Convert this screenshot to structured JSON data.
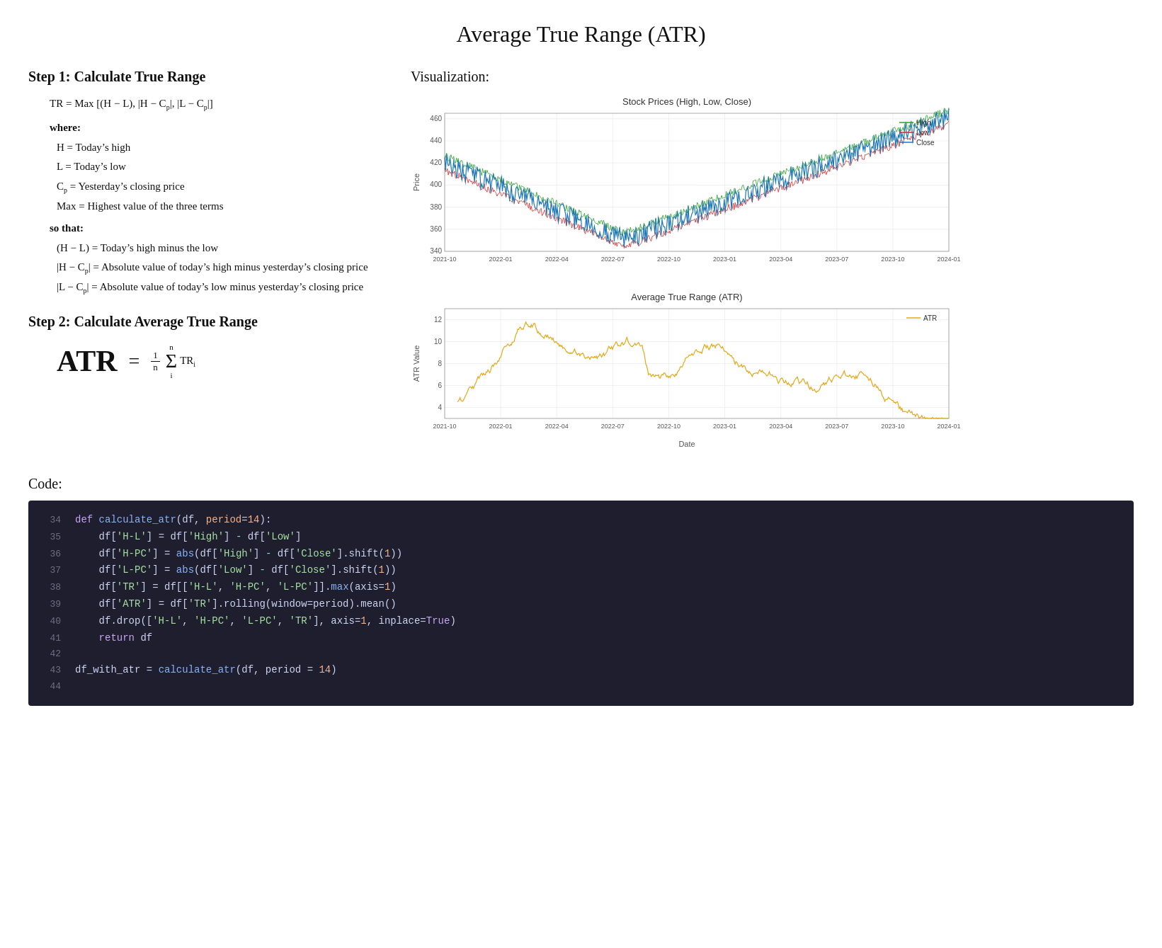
{
  "title": "Average True Range (ATR)",
  "step1": {
    "title": "Step 1: Calculate True Range",
    "formula": "TR = Max [(H − L), |H − C_p|, |L − C_p|]",
    "where_label": "where:",
    "variables": [
      "H = Today's high",
      "L = Today's low",
      "C_p = Yesterday's closing price",
      "Max = Highest value of the three terms"
    ],
    "sothat_label": "so that:",
    "terms": [
      "(H − L) = Today's high minus the low",
      "|H − C_p| = Absolute value of today's high minus yesterday's closing price",
      "|L − C_p| = Absolute value of today's low minus yesterday's closing price"
    ]
  },
  "step2": {
    "title": "Step 2: Calculate Average True Range",
    "atr_label": "ATR =",
    "formula_desc": "(1/n) Σ TR_i"
  },
  "visualization": {
    "title": "Visualization:",
    "chart1_title": "Stock Prices (High, Low, Close)",
    "chart2_title": "Average True Range (ATR)",
    "legend": {
      "high": "High",
      "low": "Low",
      "close": "Close",
      "atr": "ATR"
    },
    "xaxis_label": "Date",
    "yaxis1_label": "Price",
    "yaxis2_label": "ATR Value",
    "x_ticks": [
      "2021-10",
      "2022-01",
      "2022-04",
      "2022-07",
      "2022-10",
      "2023-01",
      "2023-04",
      "2023-07",
      "2023-10",
      "2024-01"
    ],
    "price_range": {
      "min": 340,
      "max": 460
    },
    "atr_range": {
      "min": 3,
      "max": 12
    }
  },
  "code": {
    "title": "Code:",
    "lines": [
      {
        "num": 34,
        "content": "def calculate_atr(df, period=14):"
      },
      {
        "num": 35,
        "content": "    df['H-L'] = df['High'] - df['Low']"
      },
      {
        "num": 36,
        "content": "    df['H-PC'] = abs(df['High'] - df['Close'].shift(1))"
      },
      {
        "num": 37,
        "content": "    df['L-PC'] = abs(df['Low'] - df['Close'].shift(1))"
      },
      {
        "num": 38,
        "content": "    df['TR'] = df[['H-L', 'H-PC', 'L-PC']].max(axis=1)"
      },
      {
        "num": 39,
        "content": "    df['ATR'] = df['TR'].rolling(window=period).mean()"
      },
      {
        "num": 40,
        "content": "    df.drop(['H-L', 'H-PC', 'L-PC', 'TR'], axis=1, inplace=True)"
      },
      {
        "num": 41,
        "content": "    return df"
      },
      {
        "num": 42,
        "content": ""
      },
      {
        "num": 43,
        "content": "df_with_atr = calculate_atr(df, period = 14)"
      },
      {
        "num": 44,
        "content": ""
      }
    ]
  }
}
